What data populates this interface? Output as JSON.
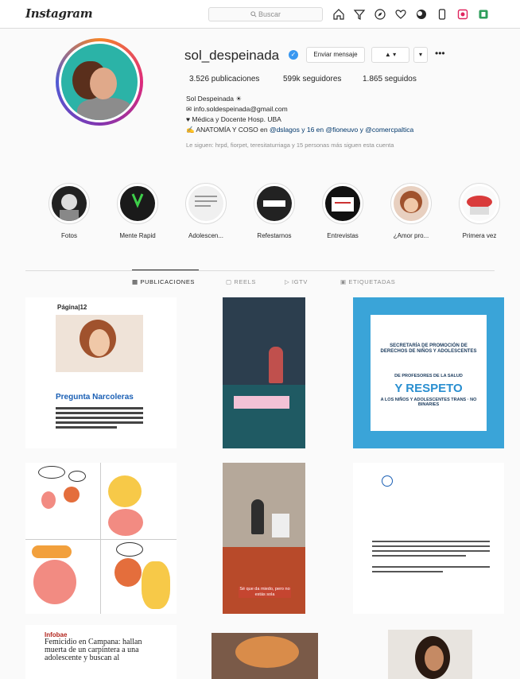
{
  "nav": {
    "logo": "Instagram",
    "search_placeholder": "Buscar",
    "icons": [
      "home-icon",
      "filter-icon",
      "explore-icon",
      "heart-icon",
      "profile-icon",
      "phone-icon",
      "record-icon",
      "bookmark-icon"
    ]
  },
  "profile": {
    "username": "sol_despeinada",
    "verified": true,
    "message_button": "Enviar mensaje",
    "follow_button": "▲ ▾",
    "dropdown_button": "▾",
    "more_button": "•••",
    "stats": {
      "posts": "3.526 publicaciones",
      "followers": "599k seguidores",
      "following": "1.865 seguidos"
    },
    "bio": {
      "name": "Sol Despeinada ☀",
      "email": "✉ info.soldespeinada@gmail.com",
      "line1": "♥ Médica y Docente Hosp. UBA",
      "line2_prefix": "✍ ANATOMÍA Y COSO en",
      "line2_mentions": "@dslagos y 16 en @fioneuvo y @comercpaltica",
      "followed_by": "Le siguen: hrpd, fiorpet, teresitaturriaga y 15 personas más siguen esta cuenta"
    }
  },
  "highlights": [
    {
      "label": "Fotos",
      "color": "#222222"
    },
    {
      "label": "Mente Rapid",
      "color": "#1a1a1a"
    },
    {
      "label": "Adolescen...",
      "color": "#e8e8e8"
    },
    {
      "label": "Refestarnos",
      "color": "#222222"
    },
    {
      "label": "Entrevistas",
      "color": "#111111"
    },
    {
      "label": "¿Amor pro...",
      "color": "#b36b4a"
    },
    {
      "label": "Primera vez",
      "color": "#d93b3b"
    }
  ],
  "tabs": [
    {
      "label": "▦ PUBLICACIONES",
      "active": true
    },
    {
      "label": "▢ REELS",
      "active": false
    },
    {
      "label": "▷ IGTV",
      "active": false
    },
    {
      "label": "▣ ETIQUETADAS",
      "active": false
    }
  ],
  "posts": {
    "p1": {
      "brand": "Página|12",
      "headline": "Pregunta Narcoleras"
    },
    "p3": {
      "line1": "SECRETARÍA DE PROMOCIÓN DE DERECHOS DE NIÑOS Y ADOLESCENTES",
      "line2": "DE PROFESORES DE LA SALUD",
      "big": "Y RESPETO",
      "line3": "A LOS NIÑOS Y ADOLESCENTES TRANS · NO BINARIES"
    },
    "p5": {
      "caption": "Sé que da miedo, pero no estás sola"
    },
    "p7": {
      "kicker": "Infobae",
      "text": "Femicidio en Campana: hallan muerta de un carpintera a una adolescente y buscan al"
    }
  },
  "colors": {
    "accent": "#3897f0",
    "border": "#dbdbdb",
    "muted": "#8e8e8e",
    "link": "#00376b"
  }
}
